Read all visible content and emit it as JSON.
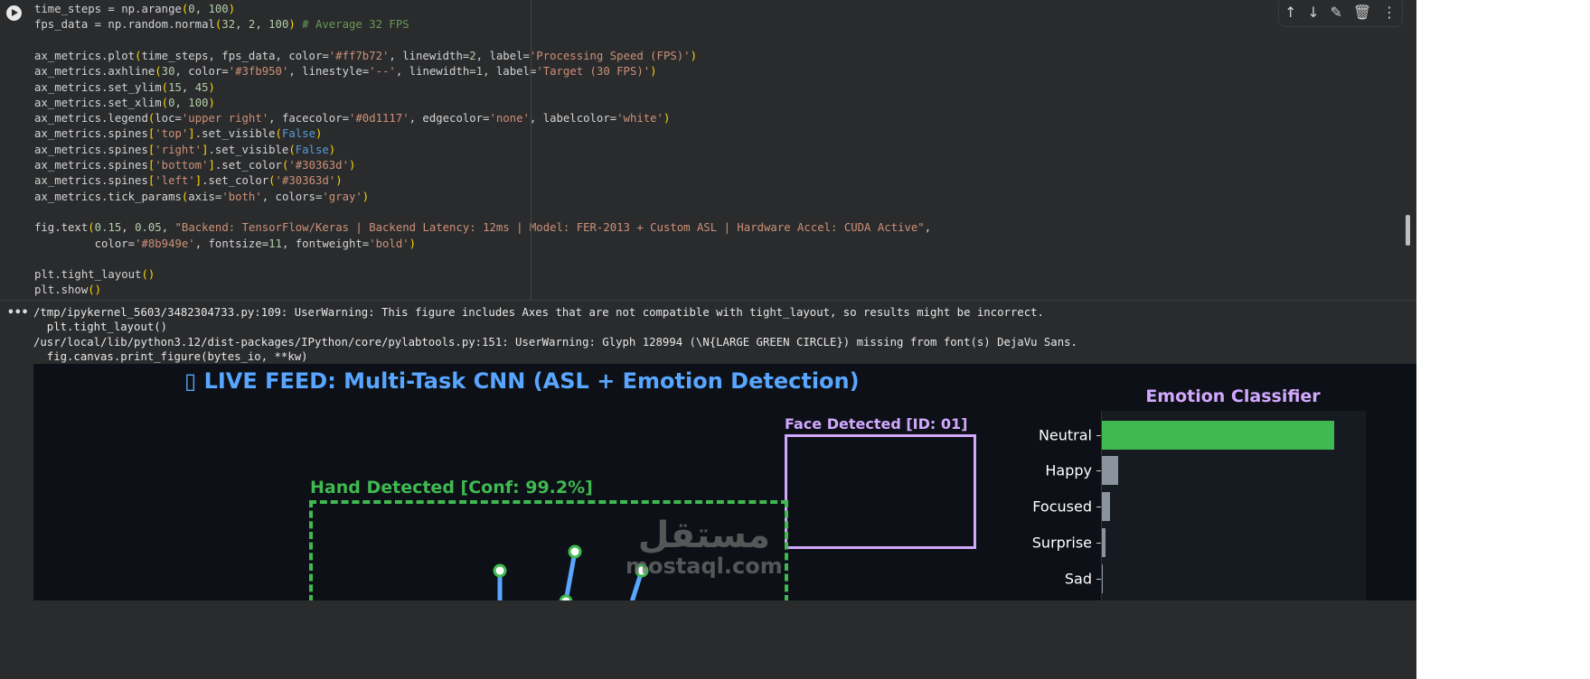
{
  "code_lines": [
    [
      [
        "time_steps = np.arange",
        ""
      ],
      [
        "(",
        "p"
      ],
      [
        "0",
        "n"
      ],
      [
        ", ",
        ""
      ],
      [
        "100",
        "n"
      ],
      [
        ")",
        "p"
      ]
    ],
    [
      [
        "fps_data = np.random.normal",
        ""
      ],
      [
        "(",
        "p"
      ],
      [
        "32",
        "n"
      ],
      [
        ", ",
        ""
      ],
      [
        "2",
        "n"
      ],
      [
        ", ",
        ""
      ],
      [
        "100",
        "n"
      ],
      [
        ")",
        "p"
      ],
      [
        " # Average 32 FPS",
        "c"
      ]
    ],
    [],
    [
      [
        "ax_metrics.plot",
        ""
      ],
      [
        "(",
        "p"
      ],
      [
        "time_steps, fps_data, color=",
        ""
      ],
      [
        "'#ff7b72'",
        "s"
      ],
      [
        ", linewidth=",
        ""
      ],
      [
        "2",
        "n"
      ],
      [
        ", label=",
        ""
      ],
      [
        "'Processing Speed (FPS)'",
        "s"
      ],
      [
        ")",
        "p"
      ]
    ],
    [
      [
        "ax_metrics.axhline",
        ""
      ],
      [
        "(",
        "p"
      ],
      [
        "30",
        "n"
      ],
      [
        ", color=",
        ""
      ],
      [
        "'#3fb950'",
        "s"
      ],
      [
        ", linestyle=",
        ""
      ],
      [
        "'--'",
        "s"
      ],
      [
        ", linewidth=",
        ""
      ],
      [
        "1",
        "n"
      ],
      [
        ", label=",
        ""
      ],
      [
        "'Target (30 FPS)'",
        "s"
      ],
      [
        ")",
        "p"
      ]
    ],
    [
      [
        "ax_metrics.set_ylim",
        ""
      ],
      [
        "(",
        "p"
      ],
      [
        "15",
        "n"
      ],
      [
        ", ",
        ""
      ],
      [
        "45",
        "n"
      ],
      [
        ")",
        "p"
      ]
    ],
    [
      [
        "ax_metrics.set_xlim",
        ""
      ],
      [
        "(",
        "p"
      ],
      [
        "0",
        "n"
      ],
      [
        ", ",
        ""
      ],
      [
        "100",
        "n"
      ],
      [
        ")",
        "p"
      ]
    ],
    [
      [
        "ax_metrics.legend",
        ""
      ],
      [
        "(",
        "p"
      ],
      [
        "loc=",
        ""
      ],
      [
        "'upper right'",
        "s"
      ],
      [
        ", facecolor=",
        ""
      ],
      [
        "'#0d1117'",
        "s"
      ],
      [
        ", edgecolor=",
        ""
      ],
      [
        "'none'",
        "s"
      ],
      [
        ", labelcolor=",
        ""
      ],
      [
        "'white'",
        "s"
      ],
      [
        ")",
        "p"
      ]
    ],
    [
      [
        "ax_metrics.spines",
        ""
      ],
      [
        "[",
        "p"
      ],
      [
        "'top'",
        "s"
      ],
      [
        "]",
        "p"
      ],
      [
        ".set_visible",
        ""
      ],
      [
        "(",
        "p"
      ],
      [
        "False",
        "k"
      ],
      [
        ")",
        "p"
      ]
    ],
    [
      [
        "ax_metrics.spines",
        ""
      ],
      [
        "[",
        "p"
      ],
      [
        "'right'",
        "s"
      ],
      [
        "]",
        "p"
      ],
      [
        ".set_visible",
        ""
      ],
      [
        "(",
        "p"
      ],
      [
        "False",
        "k"
      ],
      [
        ")",
        "p"
      ]
    ],
    [
      [
        "ax_metrics.spines",
        ""
      ],
      [
        "[",
        "p"
      ],
      [
        "'bottom'",
        "s"
      ],
      [
        "]",
        "p"
      ],
      [
        ".set_color",
        ""
      ],
      [
        "(",
        "p"
      ],
      [
        "'#30363d'",
        "s"
      ],
      [
        ")",
        "p"
      ]
    ],
    [
      [
        "ax_metrics.spines",
        ""
      ],
      [
        "[",
        "p"
      ],
      [
        "'left'",
        "s"
      ],
      [
        "]",
        "p"
      ],
      [
        ".set_color",
        ""
      ],
      [
        "(",
        "p"
      ],
      [
        "'#30363d'",
        "s"
      ],
      [
        ")",
        "p"
      ]
    ],
    [
      [
        "ax_metrics.tick_params",
        ""
      ],
      [
        "(",
        "p"
      ],
      [
        "axis=",
        ""
      ],
      [
        "'both'",
        "s"
      ],
      [
        ", colors=",
        ""
      ],
      [
        "'gray'",
        "s"
      ],
      [
        ")",
        "p"
      ]
    ],
    [],
    [
      [
        "fig.text",
        ""
      ],
      [
        "(",
        "p"
      ],
      [
        "0.15",
        "n"
      ],
      [
        ", ",
        ""
      ],
      [
        "0.05",
        "n"
      ],
      [
        ", ",
        ""
      ],
      [
        "\"Backend: TensorFlow/Keras | Backend Latency: 12ms | Model: FER-2013 + Custom ASL | Hardware Accel: CUDA Active\"",
        "s"
      ],
      [
        ",",
        ""
      ]
    ],
    [
      [
        "         color=",
        ""
      ],
      [
        "'#8b949e'",
        "s"
      ],
      [
        ", fontsize=",
        ""
      ],
      [
        "11",
        "n"
      ],
      [
        ", fontweight=",
        ""
      ],
      [
        "'bold'",
        "s"
      ],
      [
        ")",
        "p"
      ]
    ],
    [],
    [
      [
        "plt.tight_layout",
        ""
      ],
      [
        "()",
        "p"
      ]
    ],
    [
      [
        "plt.show",
        ""
      ],
      [
        "()",
        "p"
      ]
    ]
  ],
  "toolbar": {
    "up": "↑",
    "down": "↓",
    "ai_edit": "✎",
    "delete": "🗑",
    "more": "⋮"
  },
  "output_dots": "•••",
  "warnings": [
    "/tmp/ipykernel_5603/3482304733.py:109: UserWarning: This figure includes Axes that are not compatible with tight_layout, so results might be incorrect.",
    "  plt.tight_layout()",
    "/usr/local/lib/python3.12/dist-packages/IPython/core/pylabtools.py:151: UserWarning: Glyph 128994 (\\N{LARGE GREEN CIRCLE}) missing from font(s) DejaVu Sans.",
    "  fig.canvas.print_figure(bytes_io, **kw)"
  ],
  "figure": {
    "title": "▯ LIVE FEED: Multi-Task CNN (ASL + Emotion Detection)",
    "face_label": "Face Detected [ID: 01]",
    "hand_label": "Hand Detected [Conf: 99.2%]",
    "watermark_ar": "مستقل",
    "watermark_en": "mostaql.com",
    "colors": {
      "title": "#58a6ff",
      "face": "#d2a8ff",
      "hand": "#3fb950",
      "skeleton": "#58a6ff"
    }
  },
  "chart_data": {
    "type": "bar",
    "orientation": "horizontal",
    "title": "Emotion Classifier",
    "categories": [
      "Neutral",
      "Happy",
      "Focused",
      "Surprise",
      "Sad"
    ],
    "values": [
      0.88,
      0.06,
      0.03,
      0.015,
      0.005
    ],
    "xlim": [
      0,
      1
    ],
    "colors": [
      "#3fb950",
      "#8b949e",
      "#8b949e",
      "#8b949e",
      "#8b949e"
    ]
  }
}
